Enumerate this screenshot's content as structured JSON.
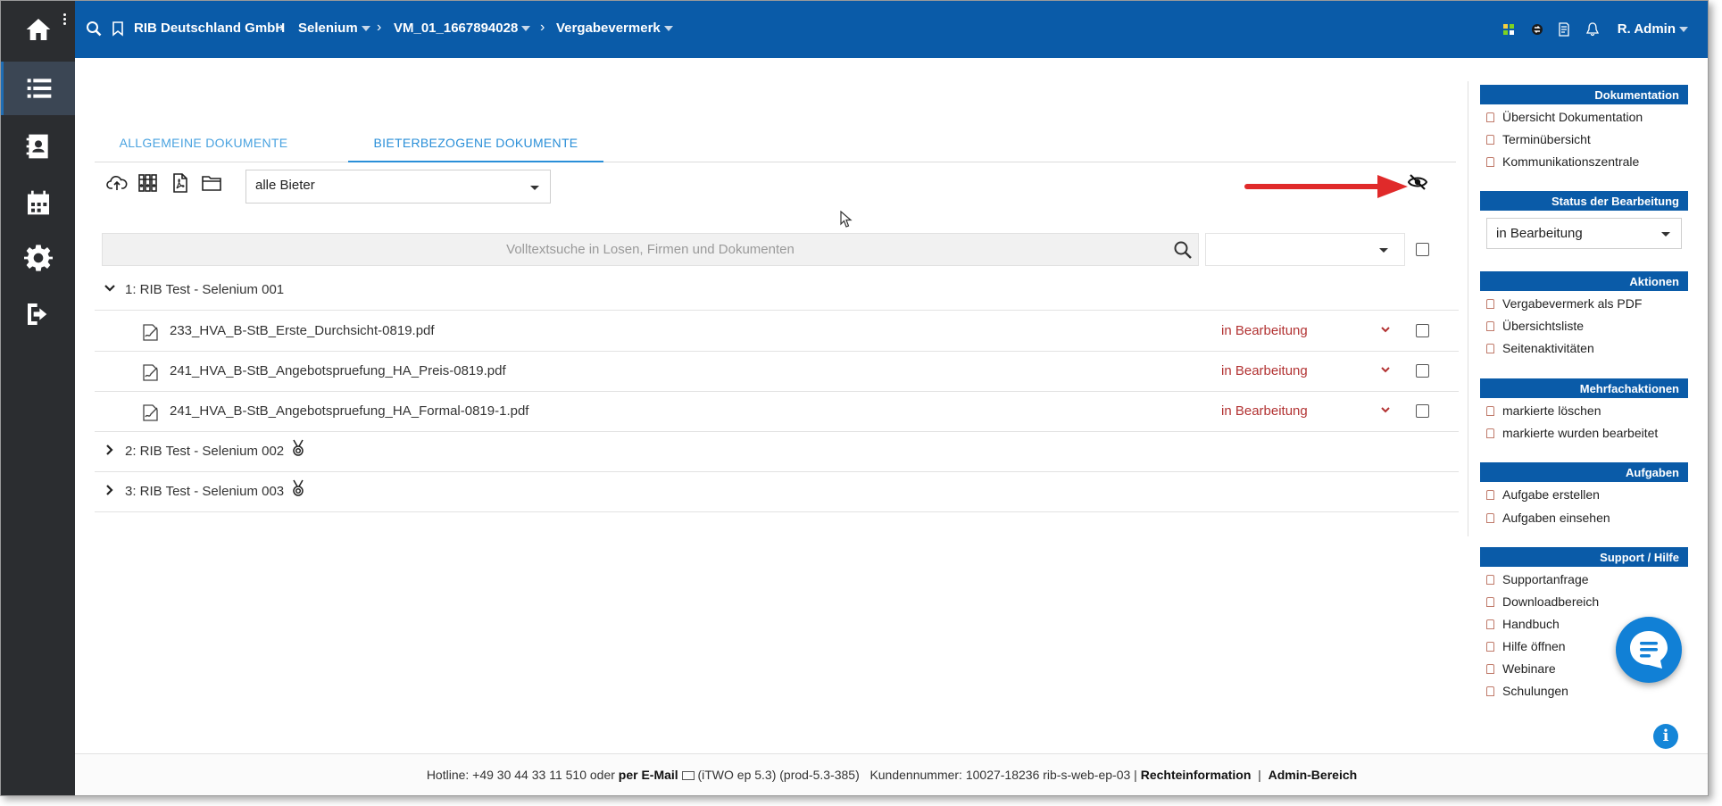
{
  "topbar": {
    "breadcrumbs": [
      "RIB Deutschland GmbH",
      "Selenium",
      "VM_01_1667894028",
      "Vergabevermerk"
    ],
    "user": "R. Admin"
  },
  "tabs": [
    "ALLGEMEINE DOKUMENTE",
    "BIETERBEZOGENE DOKUMENTE"
  ],
  "filter": {
    "bieter_selected": "alle Bieter"
  },
  "search": {
    "placeholder": "Volltextsuche in Losen, Firmen und Dokumenten"
  },
  "groups": [
    {
      "label": "1: RIB Test - Selenium 001",
      "expanded": true,
      "documents": [
        {
          "name": "233_HVA_B-StB_Erste_Durchsicht-0819.pdf",
          "status": "in Bearbeitung"
        },
        {
          "name": "241_HVA_B-StB_Angebotspruefung_HA_Preis-0819.pdf",
          "status": "in Bearbeitung"
        },
        {
          "name": "241_HVA_B-StB_Angebotspruefung_HA_Formal-0819-1.pdf",
          "status": "in Bearbeitung"
        }
      ]
    },
    {
      "label": "2: RIB Test - Selenium 002",
      "expanded": false
    },
    {
      "label": "3: RIB Test - Selenium 003",
      "expanded": false
    }
  ],
  "right_panel": {
    "dokumentation": {
      "title": "Dokumentation",
      "items": [
        "Übersicht Dokumentation",
        "Terminübersicht",
        "Kommunikationszentrale"
      ]
    },
    "status": {
      "title": "Status der Bearbeitung",
      "selected": "in Bearbeitung"
    },
    "aktionen": {
      "title": "Aktionen",
      "items": [
        "Vergabevermerk als PDF",
        "Übersichtsliste",
        "Seitenaktivitäten"
      ]
    },
    "mehrfach": {
      "title": "Mehrfachaktionen",
      "items": [
        "markierte löschen",
        "markierte wurden bearbeitet"
      ]
    },
    "aufgaben": {
      "title": "Aufgaben",
      "items": [
        "Aufgabe erstellen",
        "Aufgaben einsehen"
      ]
    },
    "support": {
      "title": "Support / Hilfe",
      "items": [
        "Supportanfrage",
        "Downloadbereich",
        "Handbuch",
        "Hilfe öffnen",
        "Webinare",
        "Schulungen"
      ]
    }
  },
  "footer": {
    "hotline": "Hotline: +49 30 44 33 11 510 oder",
    "email": "per E-Mail",
    "version": "(iTWO ep 5.3) (prod-5.3-385)",
    "kunde": "Kundennummer: 10027-18236 rib-s-web-ep-03 |",
    "recht": "Rechteinformation",
    "sep": "|",
    "admin": "Admin-Bereich"
  },
  "colors": {
    "primary": "#0a5ba8",
    "sidebar": "#2b2d30",
    "status_red": "#b23232",
    "tab_blue": "#2a8fd8"
  }
}
